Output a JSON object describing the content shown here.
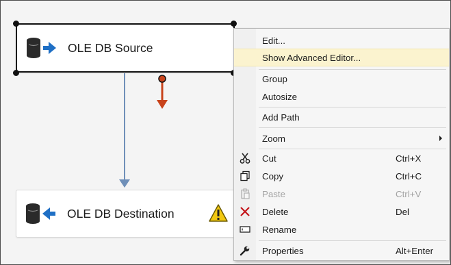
{
  "canvas": {
    "source": {
      "label": "OLE DB Source",
      "icon": "database-output-icon"
    },
    "destination": {
      "label": "OLE DB Destination",
      "icon": "database-input-icon",
      "warning_icon": "warning-icon"
    },
    "colors": {
      "data_path": "#6f8fb8",
      "error_path": "#c8431b",
      "warning": "#f2c811"
    }
  },
  "context_menu": {
    "items": [
      {
        "label": "Edit..."
      },
      {
        "label": "Show Advanced Editor...",
        "highlighted": true
      },
      {
        "label": "Group"
      },
      {
        "label": "Autosize"
      },
      {
        "label": "Add Path"
      },
      {
        "label": "Zoom",
        "submenu": true
      },
      {
        "label": "Cut",
        "shortcut": "Ctrl+X",
        "icon": "scissors-icon"
      },
      {
        "label": "Copy",
        "shortcut": "Ctrl+C",
        "icon": "copy-icon"
      },
      {
        "label": "Paste",
        "shortcut": "Ctrl+V",
        "icon": "paste-icon",
        "disabled": true
      },
      {
        "label": "Delete",
        "shortcut": "Del",
        "icon": "delete-x-icon"
      },
      {
        "label": "Rename",
        "icon": "rename-icon"
      },
      {
        "label": "Properties",
        "shortcut": "Alt+Enter",
        "icon": "wrench-icon"
      }
    ]
  }
}
